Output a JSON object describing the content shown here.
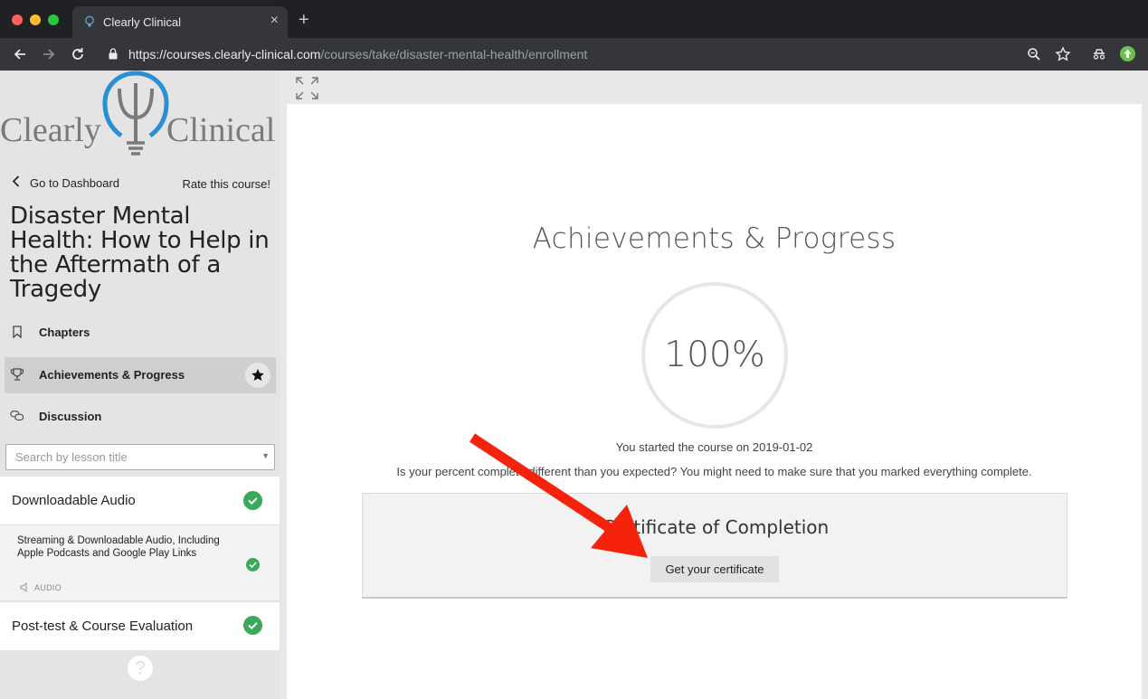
{
  "browser": {
    "tab_title": "Clearly Clinical",
    "tab_close": "×",
    "new_tab": "+",
    "url_host": "https://courses.clearly-clinical.com",
    "url_path": "/courses/take/disaster-mental-health/enrollment"
  },
  "sidebar": {
    "logo_left": "Clearly",
    "logo_right": "Clinical",
    "dashboard_link": "Go to Dashboard",
    "rate_link": "Rate this course!",
    "course_title": "Disaster Mental Health: How to Help in the Aftermath of a Tragedy",
    "nav": {
      "chapters": "Chapters",
      "achievements": "Achievements & Progress",
      "discussion": "Discussion"
    },
    "search_placeholder": "Search by lesson title",
    "chapters": [
      {
        "title": "Downloadable Audio",
        "completed": true,
        "lessons": [
          {
            "title": "Streaming & Downloadable Audio, Including Apple Podcasts and Google Play Links",
            "type": "AUDIO",
            "completed": true
          }
        ]
      },
      {
        "title": "Post-test & Course Evaluation",
        "completed": true
      }
    ],
    "help": "?"
  },
  "main": {
    "title": "Achievements & Progress",
    "progress": 100,
    "progress_label": "100%",
    "started_text": "You started the course on 2019-01-02",
    "hint_text": "Is your percent complete different than you expected? You might need to make sure that you marked everything complete.",
    "certificate_title": "Certificate of Completion",
    "certificate_button": "Get your certificate"
  },
  "colors": {
    "accent_blue": "#2b8fd4",
    "check_green": "#3aaa5a",
    "arrow_red": "#f5230c"
  }
}
